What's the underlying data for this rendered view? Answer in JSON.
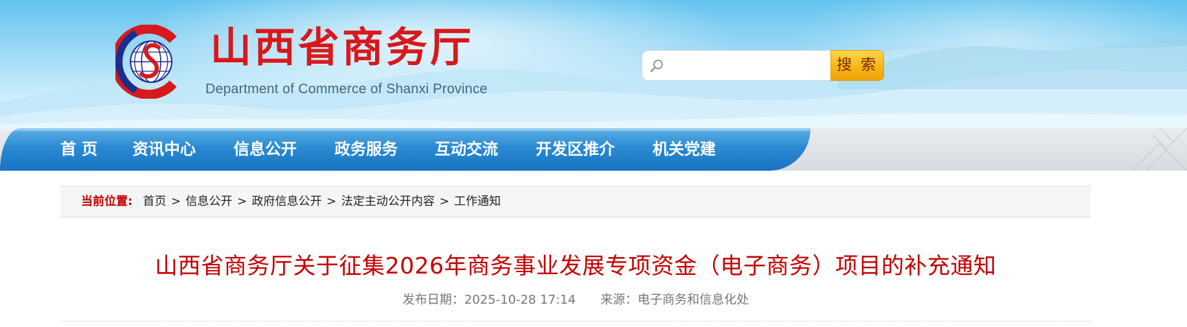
{
  "header": {
    "site_title": "山西省商务厅",
    "site_subtitle": "Department of Commerce of Shanxi Province",
    "logo_icon": "commerce-emblem-icon",
    "colors": {
      "title_red": "#d7191d",
      "sky_blue": "#63c4ef"
    }
  },
  "search": {
    "placeholder": "",
    "value": "",
    "button_label": "搜 索",
    "icon": "search-icon"
  },
  "nav": {
    "items": [
      {
        "label": "首  页"
      },
      {
        "label": "资讯中心"
      },
      {
        "label": "信息公开"
      },
      {
        "label": "政务服务"
      },
      {
        "label": "互动交流"
      },
      {
        "label": "开发区推介"
      },
      {
        "label": "机关党建"
      }
    ],
    "colors": {
      "bar_blue": "#1a73c1"
    }
  },
  "breadcrumb": {
    "label": "当前位置:",
    "items": [
      "首页",
      "信息公开",
      "政府信息公开",
      "法定主动公开内容",
      "工作通知"
    ],
    "separator": ">"
  },
  "article": {
    "title": "山西省商务厅关于征集2026年商务事业发展专项资金（电子商务）项目的补充通知",
    "publish_date": "发布日期：2025-10-28 17:14",
    "source": "来源：电子商务和信息化处",
    "colors": {
      "title_red": "#c40000"
    }
  }
}
